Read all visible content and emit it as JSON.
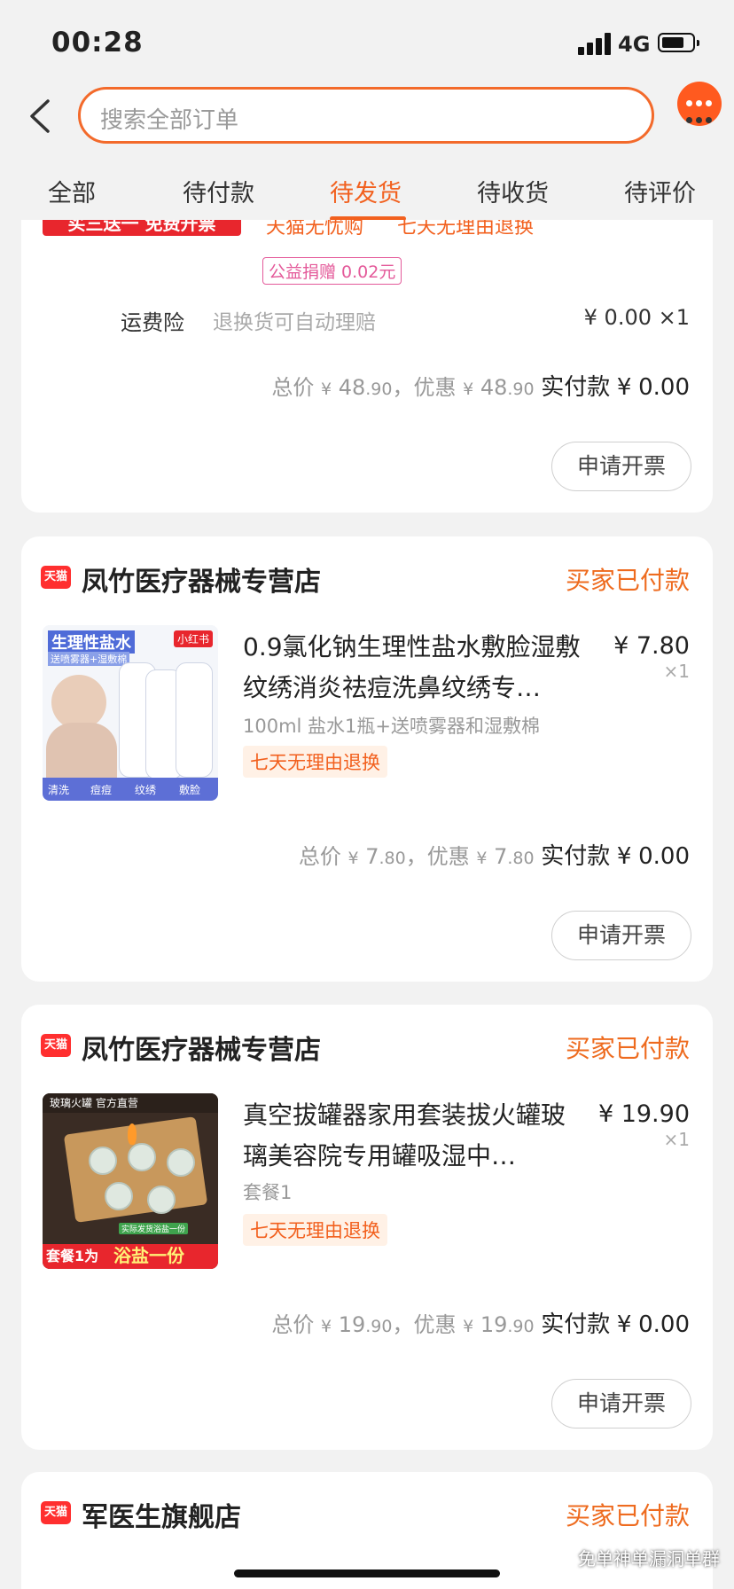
{
  "status": {
    "time": "00:28",
    "network": "4G"
  },
  "search": {
    "placeholder": "搜索全部订单"
  },
  "tabs": [
    "全部",
    "待付款",
    "待发货",
    "待收货",
    "待评价"
  ],
  "colors": {
    "accent": "#f2601e",
    "tmall_red": "#ff2f2f",
    "background": "#f2f2f2"
  },
  "card0": {
    "banner": "买三送一 免费开票",
    "tag1": "天猫无忧购",
    "tag2": "七天无理由退换",
    "donation": "公益捐赠 0.02元",
    "insurance_label": "运费险",
    "insurance_desc": "退换货可自动理赔",
    "insurance_price": "¥ 0.00 ×1",
    "total": {
      "label": "总价",
      "int": "48",
      "dec": ".90",
      "discount_label": "，优惠",
      "dint": "48",
      "ddec": ".90",
      "paid_label": "实付款",
      "pint": "0",
      "pdec": ".00"
    },
    "invoice": "申请开票"
  },
  "orders": [
    {
      "shop_logo": "天猫",
      "shop": "凤竹医疗器械专营店",
      "status": "买家已付款",
      "title": "0.9氯化钠生理性盐水敷脸湿敷纹绣消炎祛痘洗鼻纹绣专…",
      "sku": "100ml 盐水1瓶+送喷雾器和湿敷棉",
      "tag": "七天无理由退换",
      "price": "¥ 7.80",
      "qty": "×1",
      "image_texts": {
        "top": "生理性盐水",
        "sub": "送喷雾器+湿敷棉",
        "badge": "小红书",
        "b1": "清洗",
        "b2": "痘痘",
        "b3": "纹绣",
        "b4": "敷脸"
      },
      "total": {
        "label": "总价",
        "int": "7",
        "dec": ".80",
        "discount_label": "，优惠",
        "dint": "7",
        "ddec": ".80",
        "paid_label": "实付款",
        "pint": "0",
        "pdec": ".00"
      },
      "invoice": "申请开票"
    },
    {
      "shop_logo": "天猫",
      "shop": "凤竹医疗器械专营店",
      "status": "买家已付款",
      "title": "真空拔罐器家用套装拔火罐玻璃美容院专用罐吸湿中…",
      "sku": "套餐1",
      "tag": "七天无理由退换",
      "price": "¥ 19.90",
      "qty": "×1",
      "image_texts": {
        "top": "玻璃火罐 官方直营",
        "note": "实际发货浴盐一份",
        "b1": "套餐1为",
        "b2": "浴盐一份"
      },
      "total": {
        "label": "总价",
        "int": "19",
        "dec": ".90",
        "discount_label": "，优惠",
        "dint": "19",
        "ddec": ".90",
        "paid_label": "实付款",
        "pint": "0",
        "pdec": ".00"
      },
      "invoice": "申请开票"
    }
  ],
  "card3": {
    "shop_logo": "天猫",
    "shop": "军医生旗舰店",
    "status": "买家已付款"
  },
  "watermark": "免单神单漏洞单群"
}
